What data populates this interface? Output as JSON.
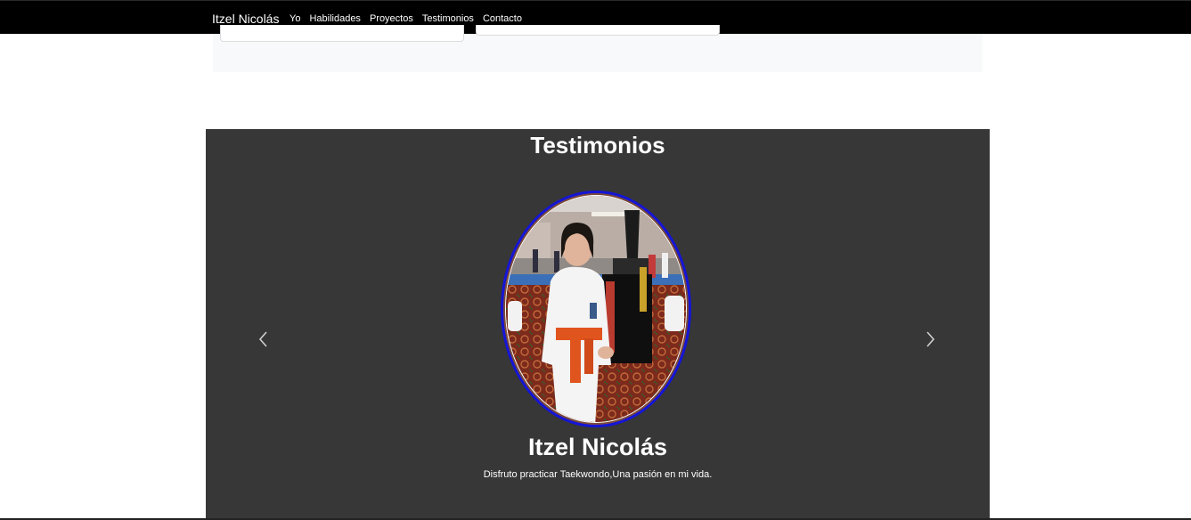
{
  "navbar": {
    "brand": "Itzel Nicolás",
    "links": [
      "Yo",
      "Habilidades",
      "Proyectos",
      "Testimonios",
      "Contacto"
    ]
  },
  "testimonials": {
    "title": "Testimonios",
    "items": [
      {
        "name": "Itzel Nicolás",
        "quote": "Disfruto practicar Taekwondo,Una pasión en mi vida.",
        "photo_icon": "person-photo"
      }
    ],
    "controls": {
      "prev_icon": "chevron-left-icon",
      "next_icon": "chevron-right-icon"
    }
  },
  "colors": {
    "navbar_bg": "#000000",
    "section_bg": "#373737",
    "prev_section_bg": "#f8f9fa",
    "photo_border": "#1515d6"
  }
}
